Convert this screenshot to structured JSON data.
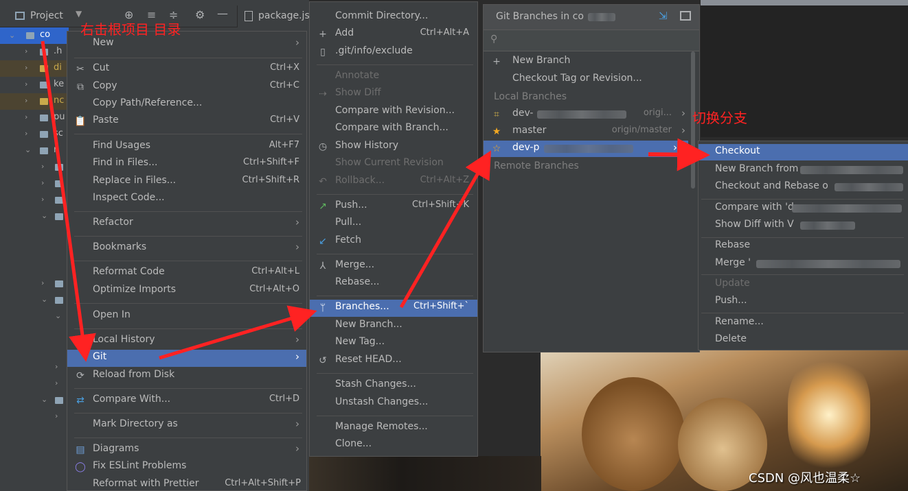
{
  "project": {
    "header_label": "Project",
    "root_label": "co",
    "editor_tab": "package.js",
    "tree_rows": [
      ".h",
      "di",
      "ke",
      "nc",
      "pu",
      "sc",
      "r",
      "",
      "",
      "",
      "",
      "",
      "",
      "",
      "",
      "",
      "",
      "",
      "",
      ""
    ]
  },
  "context_menu": {
    "items": [
      {
        "label": "New",
        "shortcut": "",
        "arrow": true
      },
      {
        "label": "Cut",
        "shortcut": "Ctrl+X"
      },
      {
        "label": "Copy",
        "shortcut": "Ctrl+C"
      },
      {
        "label": "Copy Path/Reference...",
        "shortcut": ""
      },
      {
        "label": "Paste",
        "shortcut": "Ctrl+V"
      },
      {
        "label": "Find Usages",
        "shortcut": "Alt+F7"
      },
      {
        "label": "Find in Files...",
        "shortcut": "Ctrl+Shift+F"
      },
      {
        "label": "Replace in Files...",
        "shortcut": "Ctrl+Shift+R"
      },
      {
        "label": "Inspect Code...",
        "shortcut": ""
      },
      {
        "label": "Refactor",
        "shortcut": "",
        "arrow": true
      },
      {
        "label": "Bookmarks",
        "shortcut": "",
        "arrow": true
      },
      {
        "label": "Reformat Code",
        "shortcut": "Ctrl+Alt+L"
      },
      {
        "label": "Optimize Imports",
        "shortcut": "Ctrl+Alt+O"
      },
      {
        "label": "Open In",
        "shortcut": "",
        "arrow": true
      },
      {
        "label": "Local History",
        "shortcut": "",
        "arrow": true
      },
      {
        "label": "Git",
        "shortcut": "",
        "arrow": true
      },
      {
        "label": "Reload from Disk",
        "shortcut": ""
      },
      {
        "label": "Compare With...",
        "shortcut": "Ctrl+D"
      },
      {
        "label": "Mark Directory as",
        "shortcut": "",
        "arrow": true
      },
      {
        "label": "Diagrams",
        "shortcut": "",
        "arrow": true
      },
      {
        "label": "Fix ESLint Problems",
        "shortcut": ""
      },
      {
        "label": "Reformat with Prettier",
        "shortcut": "Ctrl+Alt+Shift+P"
      }
    ]
  },
  "git_menu": {
    "items": [
      {
        "label": "Commit Directory...",
        "shortcut": ""
      },
      {
        "label": "Add",
        "shortcut": "Ctrl+Alt+A"
      },
      {
        "label": ".git/info/exclude",
        "shortcut": ""
      },
      {
        "label": "Annotate",
        "shortcut": ""
      },
      {
        "label": "Show Diff",
        "shortcut": ""
      },
      {
        "label": "Compare with Revision...",
        "shortcut": ""
      },
      {
        "label": "Compare with Branch...",
        "shortcut": ""
      },
      {
        "label": "Show History",
        "shortcut": ""
      },
      {
        "label": "Show Current Revision",
        "shortcut": ""
      },
      {
        "label": "Rollback...",
        "shortcut": "Ctrl+Alt+Z"
      },
      {
        "label": "Push...",
        "shortcut": "Ctrl+Shift+K"
      },
      {
        "label": "Pull...",
        "shortcut": ""
      },
      {
        "label": "Fetch",
        "shortcut": ""
      },
      {
        "label": "Merge...",
        "shortcut": ""
      },
      {
        "label": "Rebase...",
        "shortcut": ""
      },
      {
        "label": "Branches...",
        "shortcut": "Ctrl+Shift+`"
      },
      {
        "label": "New Branch...",
        "shortcut": ""
      },
      {
        "label": "New Tag...",
        "shortcut": ""
      },
      {
        "label": "Reset HEAD...",
        "shortcut": ""
      },
      {
        "label": "Stash Changes...",
        "shortcut": ""
      },
      {
        "label": "Unstash Changes...",
        "shortcut": ""
      },
      {
        "label": "Manage Remotes...",
        "shortcut": ""
      },
      {
        "label": "Clone...",
        "shortcut": ""
      }
    ]
  },
  "branches_popup": {
    "title": "Git Branches in co",
    "new_branch": "New Branch",
    "checkout_tag": "Checkout Tag or Revision...",
    "local_header": "Local Branches",
    "remote_header": "Remote Branches",
    "local": [
      {
        "name": "dev-",
        "tracking": "origi..."
      },
      {
        "name": "master",
        "tracking": "origin/master"
      },
      {
        "name": "dev-p",
        "tracking": ""
      }
    ]
  },
  "branch_actions": {
    "items": [
      {
        "label": "Checkout"
      },
      {
        "label": "New Branch from"
      },
      {
        "label": "Checkout and Rebase o"
      },
      {
        "label": "Compare with 'd"
      },
      {
        "label": "Show Diff with V"
      },
      {
        "label": "Rebase"
      },
      {
        "label": "Merge '"
      },
      {
        "label": "Update"
      },
      {
        "label": "Push..."
      },
      {
        "label": "Rename..."
      },
      {
        "label": "Delete"
      }
    ]
  },
  "annotations": {
    "right_click": "右击根项目 目录",
    "switch_branch": "切换分支"
  },
  "watermark": "CSDN @风也温柔☆",
  "colors": {
    "selection": "#4b6eaf",
    "annotation": "#ff2222",
    "star": "#f4a922"
  }
}
